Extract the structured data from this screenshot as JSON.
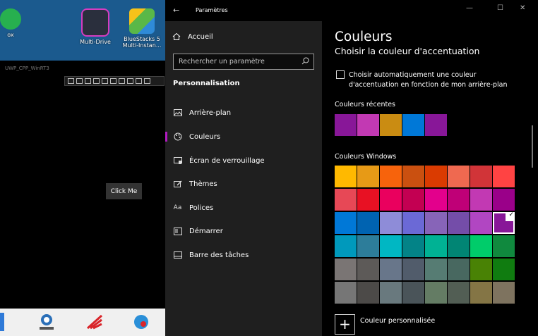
{
  "desktop": {
    "icons": [
      {
        "label": "ox",
        "icon": "nox-icon"
      },
      {
        "label": "Multi-Drive",
        "icon": "nox-multi-drive-icon"
      },
      {
        "label": "BlueStacks 5 Multi-Instan...",
        "icon": "bluestacks-icon"
      }
    ]
  },
  "uwp_app": {
    "title": "UWP_CPP_WinRT3",
    "button_label": "Click Me"
  },
  "settings": {
    "window_title": "Paramètres",
    "controls": {
      "minimize": "—",
      "maximize": "☐",
      "close": "✕"
    },
    "home_label": "Accueil",
    "search_placeholder": "Rechercher un paramètre",
    "section_heading": "Personnalisation",
    "nav": [
      {
        "label": "Arrière-plan",
        "icon": "image-icon"
      },
      {
        "label": "Couleurs",
        "icon": "palette-icon",
        "active": true
      },
      {
        "label": "Écran de verrouillage",
        "icon": "lock-screen-icon"
      },
      {
        "label": "Thèmes",
        "icon": "brush-icon"
      },
      {
        "label": "Polices",
        "icon": "font-icon"
      },
      {
        "label": "Démarrer",
        "icon": "start-icon"
      },
      {
        "label": "Barre des tâches",
        "icon": "taskbar-icon"
      }
    ],
    "page_title": "Couleurs",
    "accent_heading": "Choisir la couleur d'accentuation",
    "auto_checkbox_label": "Choisir automatiquement une couleur d'accentuation en fonction de mon arrière-plan",
    "auto_checkbox_checked": false,
    "recent_label": "Couleurs récentes",
    "recent_colors": [
      "#881798",
      "#c239b3",
      "#ca8c12",
      "#0078d7",
      "#881798"
    ],
    "windows_label": "Couleurs Windows",
    "windows_colors": [
      "#ffb900",
      "#e79a16",
      "#f7630c",
      "#ca5010",
      "#da3b01",
      "#ef6950",
      "#d13438",
      "#ff4343",
      "#e74856",
      "#e81123",
      "#ea005e",
      "#c30052",
      "#e3008c",
      "#bf0077",
      "#c239b3",
      "#9a0089",
      "#0078d7",
      "#0063b1",
      "#8e8cd8",
      "#6b69d6",
      "#8764b8",
      "#744da9",
      "#b146c2",
      "#881798",
      "#0099bc",
      "#2d7d9a",
      "#00b7c3",
      "#038387",
      "#00b294",
      "#018574",
      "#00cc6a",
      "#10893e",
      "#7a7574",
      "#5d5a58",
      "#68768a",
      "#515c6b",
      "#567c73",
      "#486860",
      "#498205",
      "#107c10",
      "#767676",
      "#4c4a48",
      "#69797e",
      "#4a5459",
      "#647c64",
      "#525e54",
      "#847545",
      "#7e735f"
    ],
    "selected_index": 23,
    "custom_label": "Couleur personnalisée"
  }
}
